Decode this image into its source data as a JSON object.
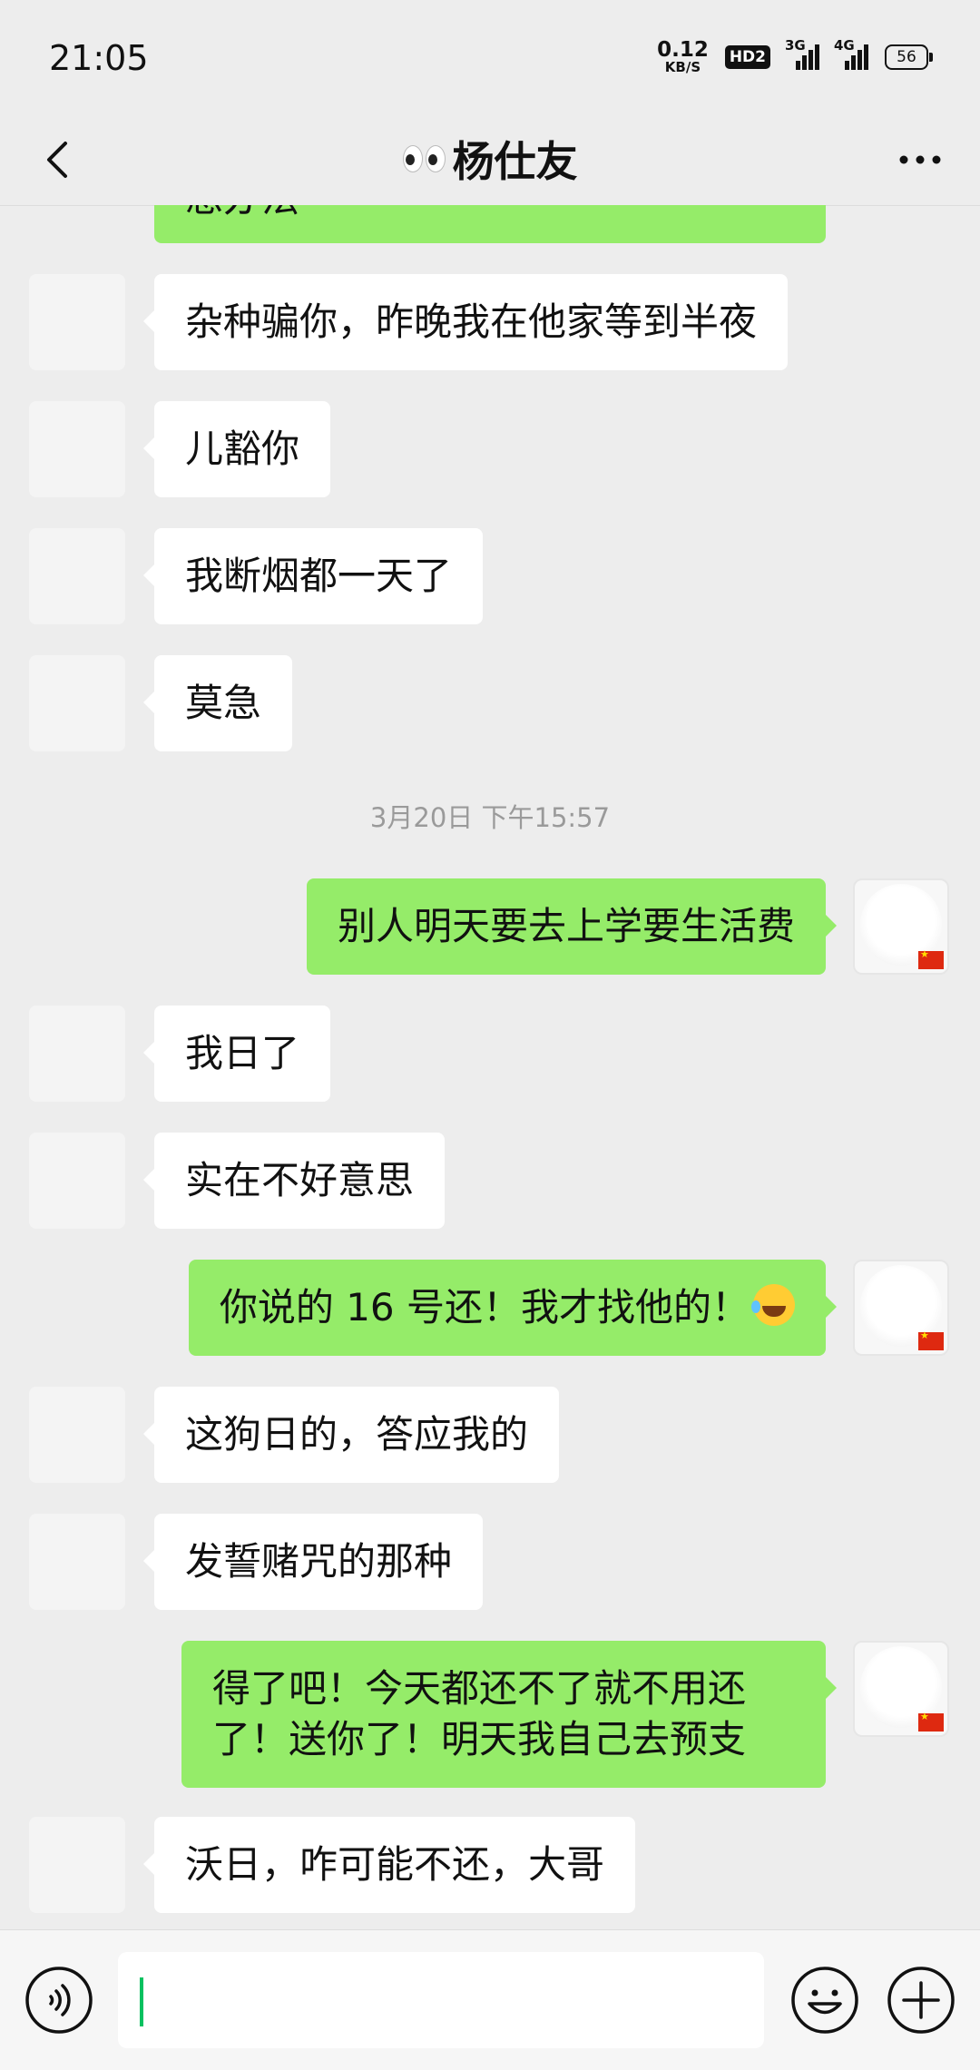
{
  "status_bar": {
    "time": "21:05",
    "net_speed_value": "0.12",
    "net_speed_unit": "KB/S",
    "hd_badge": "HD2",
    "signal1_label": "3G",
    "signal2_label": "4G",
    "battery": "56"
  },
  "header": {
    "title": "杨仕友",
    "title_prefix_icon": "eyes-emoji"
  },
  "messages": [
    {
      "side": "out",
      "text": "想办法",
      "partial": true
    },
    {
      "side": "in",
      "text": "杂种骗你，昨晚我在他家等到半夜"
    },
    {
      "side": "in",
      "text": "儿豁你"
    },
    {
      "side": "in",
      "text": "我断烟都一天了"
    },
    {
      "side": "in",
      "text": "莫急"
    },
    {
      "type": "timestamp",
      "text": "3月20日 下午15:57"
    },
    {
      "side": "out",
      "text": "别人明天要去上学要生活费"
    },
    {
      "side": "in",
      "text": "我日了"
    },
    {
      "side": "in",
      "text": "实在不好意思"
    },
    {
      "side": "out",
      "text": "你说的 16 号还！我才找他的！",
      "emoji": "laughing-tears-emoji"
    },
    {
      "side": "in",
      "text": "这狗日的，答应我的"
    },
    {
      "side": "in",
      "text": "发誓赌咒的那种"
    },
    {
      "side": "out",
      "text": "得了吧！今天都还不了就不用还了！送你了！明天我自己去预支"
    },
    {
      "side": "in",
      "text": "沃日，咋可能不还，大哥"
    }
  ],
  "input": {
    "value": "",
    "placeholder": ""
  },
  "colors": {
    "background": "#ededed",
    "incoming_bubble": "#ffffff",
    "outgoing_bubble": "#95ec69",
    "caret": "#07c160"
  }
}
